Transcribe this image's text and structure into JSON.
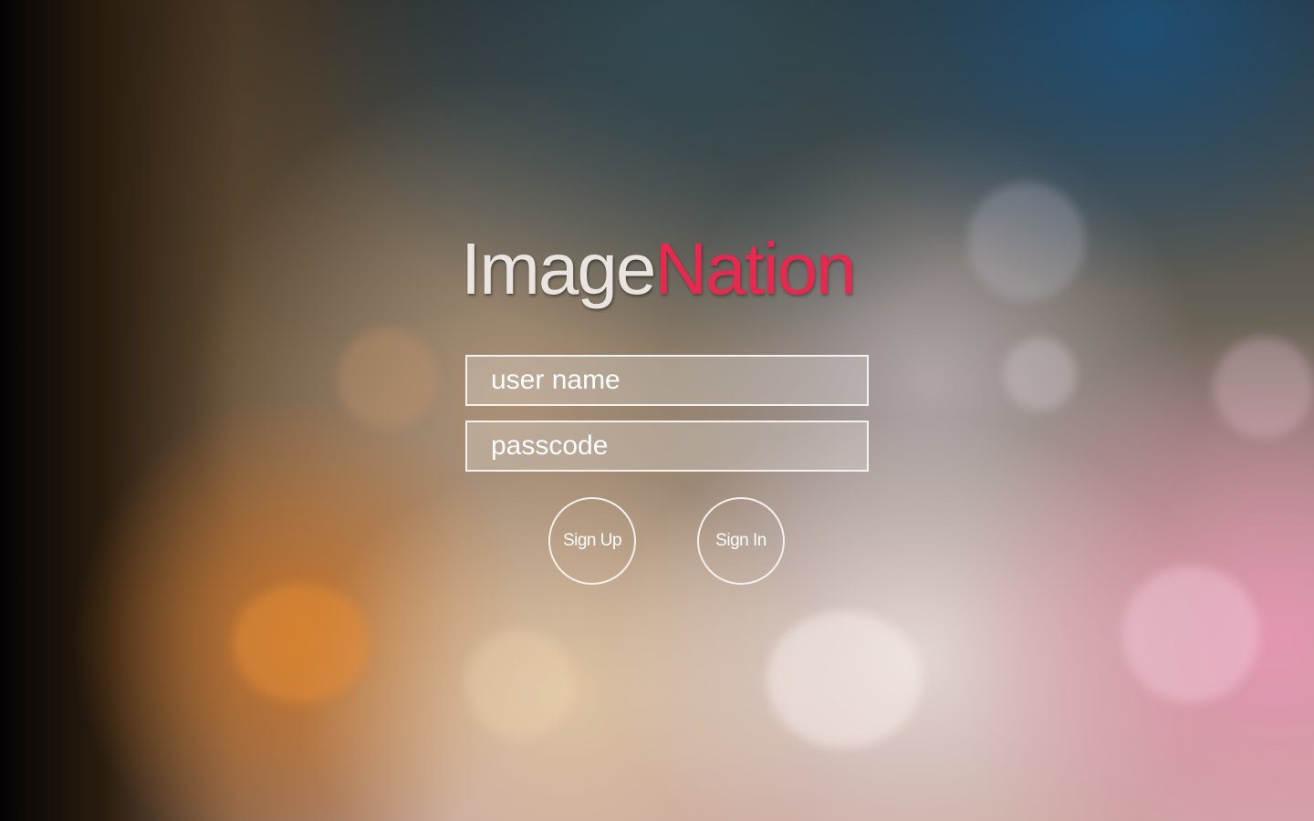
{
  "logo": {
    "part1": "Image",
    "part2": "Nation",
    "part1_color": "#e9e4e0",
    "part2_color": "#e8294f"
  },
  "login": {
    "username_placeholder": "user name",
    "username_value": "",
    "passcode_placeholder": "passcode",
    "passcode_value": ""
  },
  "buttons": {
    "signup_label": "Sign Up",
    "signin_label": "Sign In"
  },
  "background": {
    "description_colors": [
      "#050403",
      "#1e5078",
      "#c8732a",
      "#e696b4",
      "#ebe1e1"
    ]
  }
}
